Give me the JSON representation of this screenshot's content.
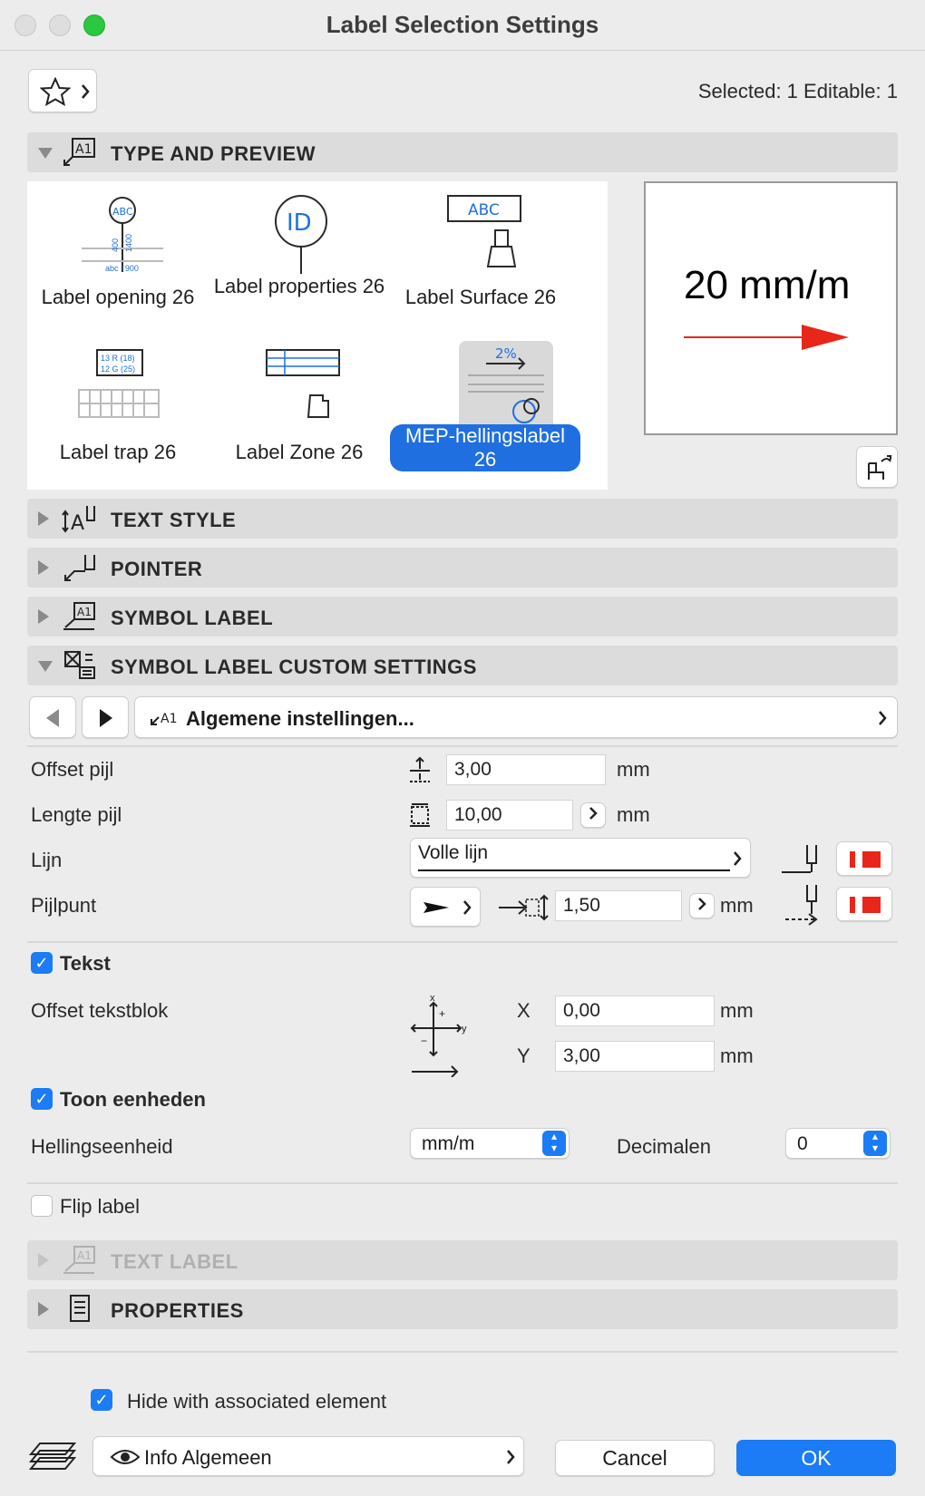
{
  "window": {
    "title": "Label Selection Settings"
  },
  "header": {
    "selection_info": "Selected: 1 Editable: 1"
  },
  "panels": {
    "type_preview": "TYPE AND PREVIEW",
    "text_style": "TEXT STYLE",
    "pointer": "POINTER",
    "symbol_label": "SYMBOL LABEL",
    "custom_settings": "SYMBOL LABEL CUSTOM SETTINGS",
    "text_label": "TEXT LABEL",
    "properties": "PROPERTIES"
  },
  "gallery": [
    {
      "label": "Label opening 26"
    },
    {
      "label": "Label properties 26"
    },
    {
      "label": "Label Surface 26"
    },
    {
      "label": "Label trap 26"
    },
    {
      "label": "Label Zone 26"
    },
    {
      "label": "MEP-hellingslabel 26",
      "selected": true
    }
  ],
  "gallery_icon_text": {
    "abc": "ABC",
    "id": "ID",
    "abc2": "ABC",
    "trap1": "13 R (18)",
    "trap2": "12 G (25)",
    "pct": "2%",
    "opening_bottom": "abc | 900",
    "opening_v1": "400",
    "opening_v2": "1400"
  },
  "preview": {
    "text": "20 mm/m"
  },
  "nav": {
    "page_title": "Algemene instellingen..."
  },
  "fields": {
    "offset_pijl": {
      "label": "Offset pijl",
      "value": "3,00",
      "unit": "mm"
    },
    "lengte_pijl": {
      "label": "Lengte pijl",
      "value": "10,00",
      "unit": "mm"
    },
    "lijn": {
      "label": "Lijn",
      "value": "Volle lijn"
    },
    "pijlpunt": {
      "label": "Pijlpunt",
      "value": "1,50",
      "unit": "mm"
    }
  },
  "tekst": {
    "checkbox_label": "Tekst",
    "offset_label": "Offset tekstblok",
    "x_label": "X",
    "x_value": "0,00",
    "x_unit": "mm",
    "y_label": "Y",
    "y_value": "3,00",
    "y_unit": "mm"
  },
  "eenheden": {
    "checkbox_label": "Toon eenheden",
    "helling_label": "Hellingseenheid",
    "helling_value": "mm/m",
    "decimalen_label": "Decimalen",
    "decimalen_value": "0"
  },
  "flip": {
    "label": "Flip label"
  },
  "footer": {
    "hide_label": "Hide with associated element",
    "layer_value": "Info Algemeen",
    "cancel": "Cancel",
    "ok": "OK"
  },
  "colors": {
    "accent": "#1b7cf5",
    "pen_red": "#e8261a",
    "selected_bg": "#1f6fe0"
  }
}
